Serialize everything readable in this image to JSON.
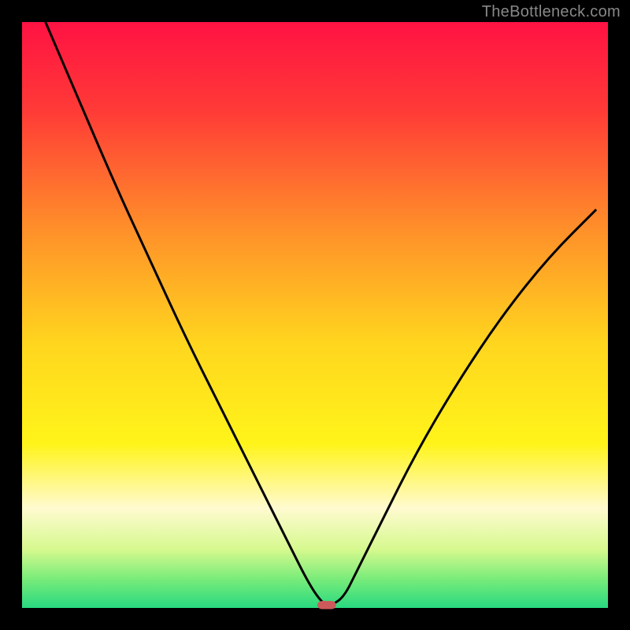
{
  "watermark": "TheBottleneck.com",
  "chart_data": {
    "type": "line",
    "title": "",
    "xlabel": "",
    "ylabel": "",
    "xlim": [
      0,
      100
    ],
    "ylim": [
      0,
      100
    ],
    "grid": false,
    "legend": false,
    "background_gradient": {
      "stops": [
        {
          "offset": 0.0,
          "color": "#ff1243"
        },
        {
          "offset": 0.15,
          "color": "#ff3a37"
        },
        {
          "offset": 0.35,
          "color": "#ff8e2a"
        },
        {
          "offset": 0.55,
          "color": "#ffd61e"
        },
        {
          "offset": 0.72,
          "color": "#fff41a"
        },
        {
          "offset": 0.83,
          "color": "#fffad0"
        },
        {
          "offset": 0.9,
          "color": "#d6f98e"
        },
        {
          "offset": 0.95,
          "color": "#7aec7a"
        },
        {
          "offset": 1.0,
          "color": "#28d980"
        }
      ]
    },
    "series": [
      {
        "name": "bottleneck-curve",
        "x": [
          4,
          10,
          16,
          22,
          28,
          34,
          40,
          45,
          49,
          51.5,
          53,
          55,
          57,
          61,
          67,
          74,
          82,
          90,
          98
        ],
        "y": [
          100,
          86,
          72,
          59,
          46,
          34,
          22,
          12,
          4,
          0.5,
          0.5,
          2,
          6,
          14,
          26,
          38,
          50,
          60,
          68
        ]
      }
    ],
    "marker": {
      "name": "optimal-point",
      "x": 52,
      "y": 0.5,
      "color": "#cc5a5a",
      "width": 3.2,
      "height": 1.4
    }
  }
}
